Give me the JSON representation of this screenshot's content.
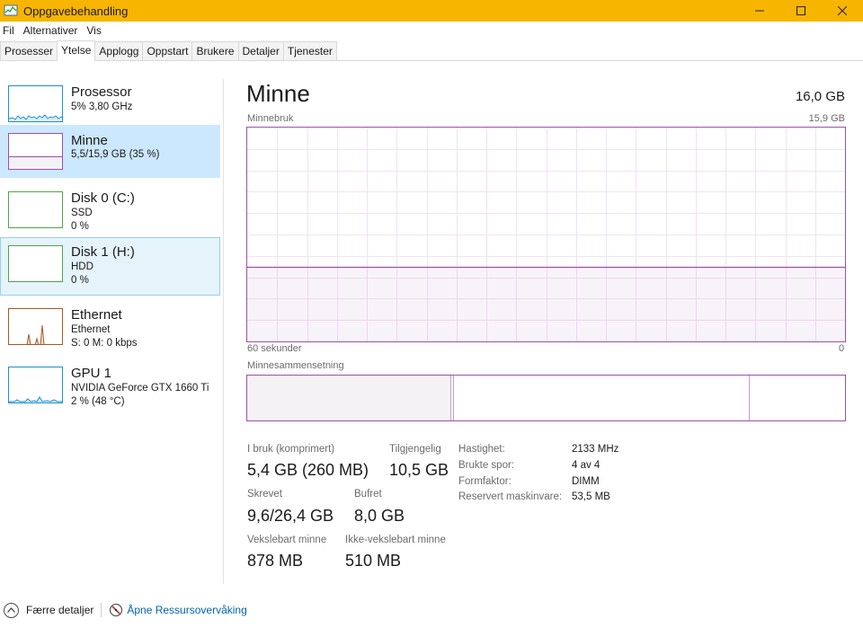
{
  "window": {
    "title": "Oppgavebehandling"
  },
  "menu": [
    "Fil",
    "Alternativer",
    "Vis"
  ],
  "tabs": [
    {
      "label": "Prosesser",
      "active": false
    },
    {
      "label": "Ytelse",
      "active": true
    },
    {
      "label": "Applogg",
      "active": false
    },
    {
      "label": "Oppstart",
      "active": false
    },
    {
      "label": "Brukere",
      "active": false
    },
    {
      "label": "Detaljer",
      "active": false
    },
    {
      "label": "Tjenester",
      "active": false
    }
  ],
  "resources": [
    {
      "name": "Prosessor",
      "sub1": "5% 3,80 GHz",
      "sub2": "",
      "color": "#1d8fd1",
      "state": "normal"
    },
    {
      "name": "Minne",
      "sub1": "5,5/15,9 GB (35 %)",
      "sub2": "",
      "color": "#9d4fb0",
      "state": "selected"
    },
    {
      "name": "Disk 0 (C:)",
      "sub1": "SSD",
      "sub2": "0 %",
      "color": "#4da744",
      "state": "normal"
    },
    {
      "name": "Disk 1 (H:)",
      "sub1": "HDD",
      "sub2": "0 %",
      "color": "#4da744",
      "state": "hover"
    },
    {
      "name": "Ethernet",
      "sub1": "Ethernet",
      "sub2": "S: 0 M: 0 kbps",
      "color": "#a7581f",
      "state": "normal"
    },
    {
      "name": "GPU 1",
      "sub1": "NVIDIA GeForce GTX 1660 Ti",
      "sub2": "2 % (48 °C)",
      "color": "#1d8fd1",
      "state": "normal"
    }
  ],
  "detail": {
    "title": "Minne",
    "total": "16,0 GB",
    "usage_label": "Minnebruk",
    "usage_max": "15,9 GB",
    "time_left": "60 sekunder",
    "time_right": "0",
    "usage_fraction": 0.35,
    "composition_label": "Minnesammensetning",
    "stats": [
      {
        "label": "I bruk (komprimert)",
        "value": "5,4 GB (260 MB)"
      },
      {
        "label": "Tilgjengelig",
        "value": "10,5 GB"
      },
      {
        "label": "Skrevet",
        "value": "9,6/26,4 GB"
      },
      {
        "label": "Bufret",
        "value": "8,0 GB"
      },
      {
        "label": "Vekslebart minne",
        "value": "878 MB"
      },
      {
        "label": "Ikke-vekslebart minne",
        "value": "510 MB"
      }
    ],
    "specs": [
      {
        "label": "Hastighet:",
        "value": "2133 MHz"
      },
      {
        "label": "Brukte spor:",
        "value": "4 av 4"
      },
      {
        "label": "Formfaktor:",
        "value": "DIMM"
      },
      {
        "label": "Reservert maskinvare:",
        "value": "53,5 MB"
      }
    ]
  },
  "bottom": {
    "fewer_details": "Færre detaljer",
    "resource_monitor": "Åpne Ressursovervåking"
  },
  "colors": {
    "titlebar": "#f7b500",
    "memory": "#9d4fb0",
    "selected": "#cce8ff",
    "link": "#0063b1"
  }
}
